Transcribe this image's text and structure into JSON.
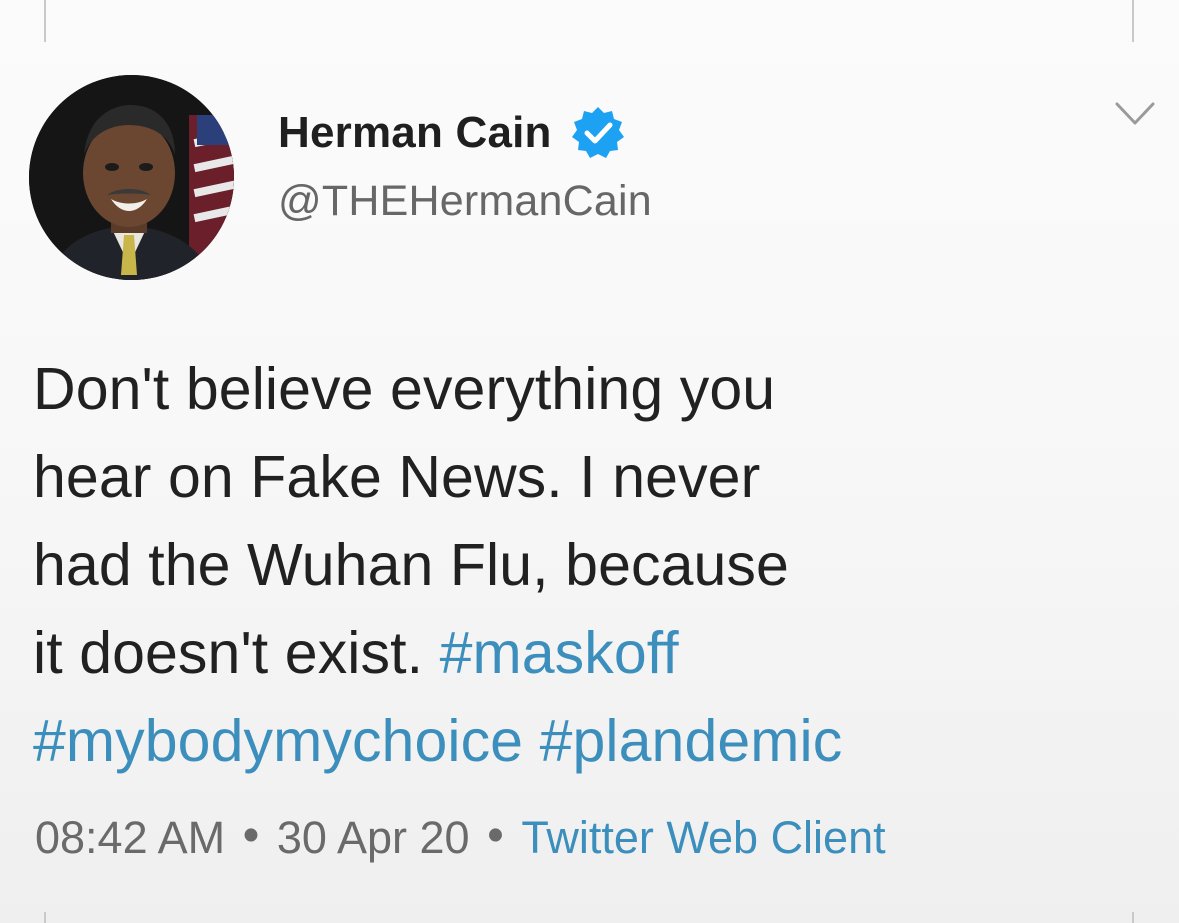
{
  "tweet": {
    "display_name": "Herman Cain",
    "handle": "@THEHermanCain",
    "verified": true,
    "text_lines": [
      "Don't believe everything you",
      "hear on Fake News. I never",
      "had the Wuhan Flu, because",
      "it doesn't exist. "
    ],
    "hashtags": [
      "#maskoff",
      "#mybodymychoice",
      "#plandemic"
    ],
    "time": "08:42 AM",
    "date": "30 Apr 20",
    "source": "Twitter Web Client",
    "separator": "•"
  },
  "icons": {
    "verified": "verified-badge-icon",
    "menu": "chevron-down-icon"
  },
  "colors": {
    "hashtag": "#3c8fbc",
    "verified": "#1da1f2",
    "meta_text": "#6a6a6a",
    "body_text": "#212121"
  }
}
